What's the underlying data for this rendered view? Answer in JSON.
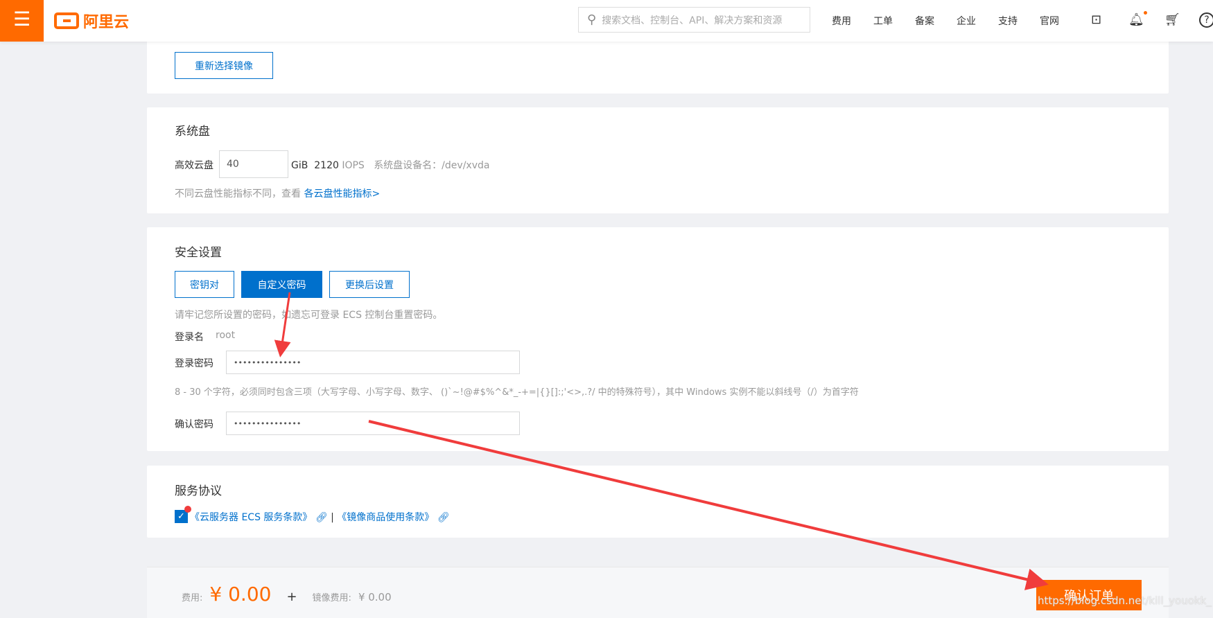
{
  "header": {
    "logo": "阿里云",
    "search_placeholder": "搜索文档、控制台、API、解决方案和资源",
    "nav": [
      "费用",
      "工单",
      "备案",
      "企业",
      "支持",
      "官网"
    ]
  },
  "image": {
    "reselect": "重新选择镜像"
  },
  "system_disk": {
    "title": "系统盘",
    "type": "高效云盘",
    "size": "40",
    "unit": "GiB",
    "iops_value": "2120",
    "iops_unit": "IOPS",
    "device_label": "系统盘设备名：/dev/xvda",
    "hint": "不同云盘性能指标不同，查看",
    "hint_link": "各云盘性能指标>"
  },
  "security": {
    "title": "安全设置",
    "tabs": [
      "密钥对",
      "自定义密码",
      "更换后设置"
    ],
    "hint": "请牢记您所设置的密码，如遗忘可登录 ECS 控制台重置密码。",
    "login_name_label": "登录名",
    "login_name": "root",
    "password_label": "登录密码",
    "password": "•••••••••••••••",
    "rule": "8 - 30 个字符，必须同时包含三项（大写字母、小写字母、数字、 ()`~!@#$%^&*_-+=|{}[]:;'<>,.?/ 中的特殊符号），其中 Windows 实例不能以斜线号（/）为首字符",
    "confirm_label": "确认密码",
    "confirm": "•••••••••••••••"
  },
  "agreement": {
    "title": "服务协议",
    "link1": "《云服务器 ECS 服务条款》",
    "sep": "|",
    "link2": "《镜像商品使用条款》",
    "checked": true
  },
  "footer": {
    "fee_label": "费用:",
    "fee": "¥ 0.00",
    "plus": "+",
    "image_fee_label": "镜像费用:",
    "image_fee": "¥ 0.00",
    "confirm": "确认订单",
    "watermark": "https://blog.csdn.net/kill_youokk_"
  },
  "colors": {
    "accent": "#ff6a00",
    "primary": "#0070cc",
    "annotation": "#f03c3c"
  }
}
